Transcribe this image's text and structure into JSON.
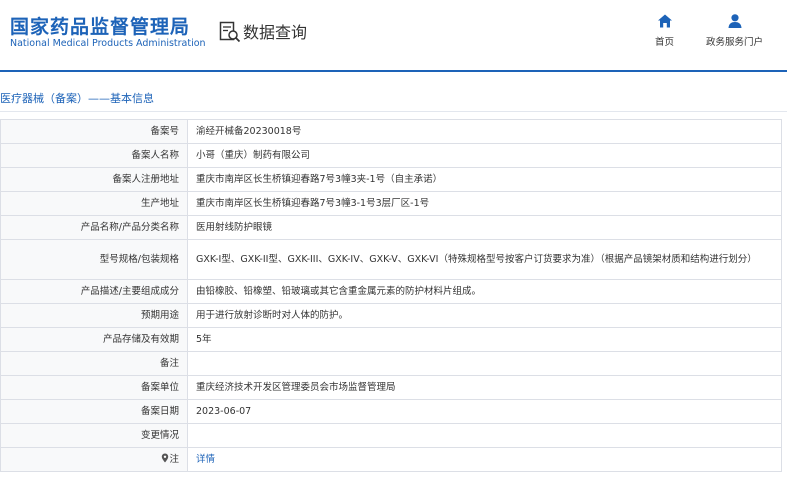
{
  "header": {
    "logo_cn": "国家药品监督管理局",
    "logo_en": "National Medical Products Administration",
    "query_title": "数据查询",
    "nav": [
      {
        "label": "首页",
        "icon": "home-icon"
      },
      {
        "label": "政务服务门户",
        "icon": "user-icon"
      }
    ]
  },
  "section": {
    "title": "医疗器械（备案）——基本信息"
  },
  "rows": [
    {
      "label": "备案号",
      "value": "渝经开械备20230018号"
    },
    {
      "label": "备案人名称",
      "value": "小哥（重庆）制药有限公司"
    },
    {
      "label": "备案人注册地址",
      "value": "重庆市南岸区长生桥镇迎春路7号3幢3夹-1号（自主承诺）"
    },
    {
      "label": "生产地址",
      "value": "重庆市南岸区长生桥镇迎春路7号3幢3-1号3层厂区-1号"
    },
    {
      "label": "产品名称/产品分类名称",
      "value": "医用射线防护眼镜"
    },
    {
      "label": "型号规格/包装规格",
      "value": "GXK-I型、GXK-II型、GXK-III、GXK-IV、GXK-V、GXK-VI（特殊规格型号按客户订货要求为准）（根据产品镜架材质和结构进行划分）"
    },
    {
      "label": "产品描述/主要组成成分",
      "value": "由铅橡胶、铅橡塑、铅玻璃或其它含重金属元素的防护材料片组成。"
    },
    {
      "label": "预期用途",
      "value": "用于进行放射诊断时对人体的防护。"
    },
    {
      "label": "产品存储及有效期",
      "value": "5年"
    },
    {
      "label": "备注",
      "value": ""
    },
    {
      "label": "备案单位",
      "value": "重庆经济技术开发区管理委员会市场监督管理局"
    },
    {
      "label": "备案日期",
      "value": "2023-06-07"
    },
    {
      "label": "变更情况",
      "value": ""
    },
    {
      "label": "注",
      "value": "详情",
      "icon": "location-pin-icon",
      "link": true
    }
  ],
  "colors": {
    "brand": "#1d63b8",
    "label_bg": "#f8f9fa",
    "border": "#dcdfe6"
  }
}
